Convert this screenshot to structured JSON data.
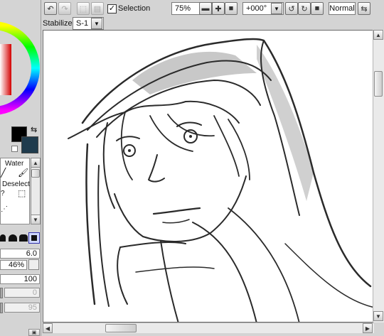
{
  "toolbar": {
    "selection_label": "Selection",
    "selection_checked": true,
    "zoom_value": "75%",
    "rotation_value": "+000°",
    "blend_mode": "Normal"
  },
  "stabilizer": {
    "label": "Stabilizer",
    "value": "S-1"
  },
  "tools": {
    "water_label": "Water",
    "deselect_label": "Deselect"
  },
  "brush": {
    "size_value": "6.0",
    "density_value": "46%",
    "value_100": "100",
    "value_0": "0",
    "value_95": "95"
  },
  "colors": {
    "foreground": "#000000",
    "background": "#1f3b4d"
  }
}
